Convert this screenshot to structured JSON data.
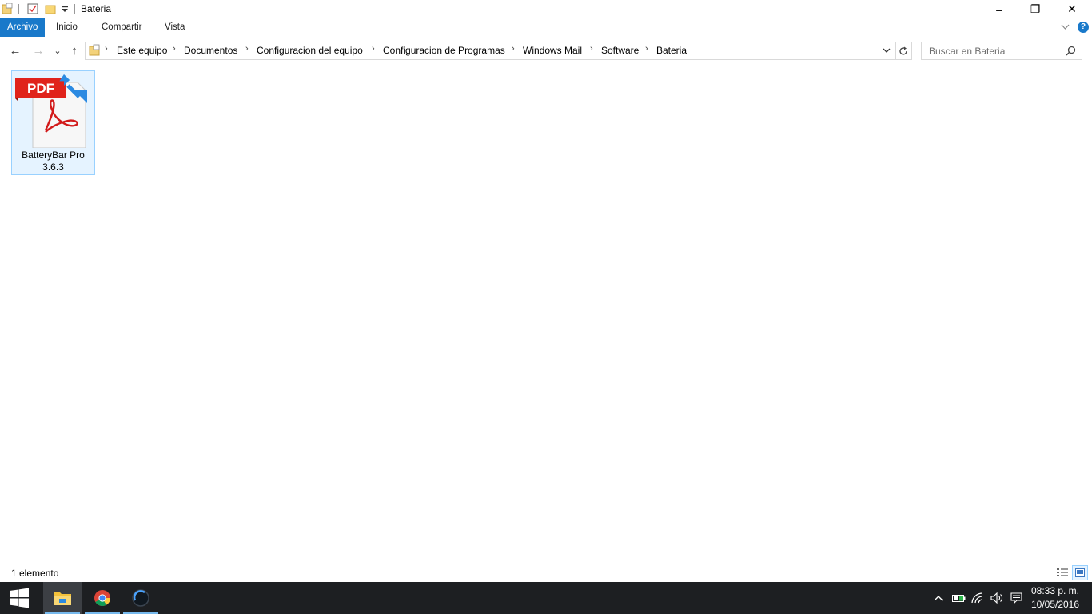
{
  "window": {
    "title": "Bateria",
    "controls": {
      "minimize": "–",
      "restore": "❐",
      "close": "✕"
    }
  },
  "ribbon": {
    "tabs": [
      {
        "label": "Archivo",
        "active": true
      },
      {
        "label": "Inicio"
      },
      {
        "label": "Compartir"
      },
      {
        "label": "Vista"
      }
    ],
    "help_label": "?"
  },
  "nav": {
    "back": "←",
    "forward": "→",
    "recent": "⌄",
    "up": "↑"
  },
  "breadcrumb": {
    "items": [
      "Este equipo",
      "Documentos",
      "Configuracion del equipo",
      "Configuracion de Programas",
      "Windows Mail",
      "Software",
      "Bateria"
    ],
    "separator": "›"
  },
  "search": {
    "placeholder": "Buscar en Bateria"
  },
  "files": [
    {
      "name": "BatteryBar Pro 3.6.3",
      "icon": "pdf-shortcut-icon",
      "badge": "PDF"
    }
  ],
  "status": {
    "count_text": "1 elemento"
  },
  "taskbar": {
    "apps": [
      "start-icon",
      "file-explorer-icon",
      "chrome-icon",
      "app-icon"
    ],
    "clock": {
      "time": "08:33 p. m.",
      "date": "10/05/2016"
    }
  },
  "colors": {
    "accent": "#1979ca",
    "selection_bg": "#e5f3ff",
    "selection_border": "#99d1ff",
    "taskbar_bg": "#1d1f22",
    "pdf_red": "#e0231b"
  }
}
